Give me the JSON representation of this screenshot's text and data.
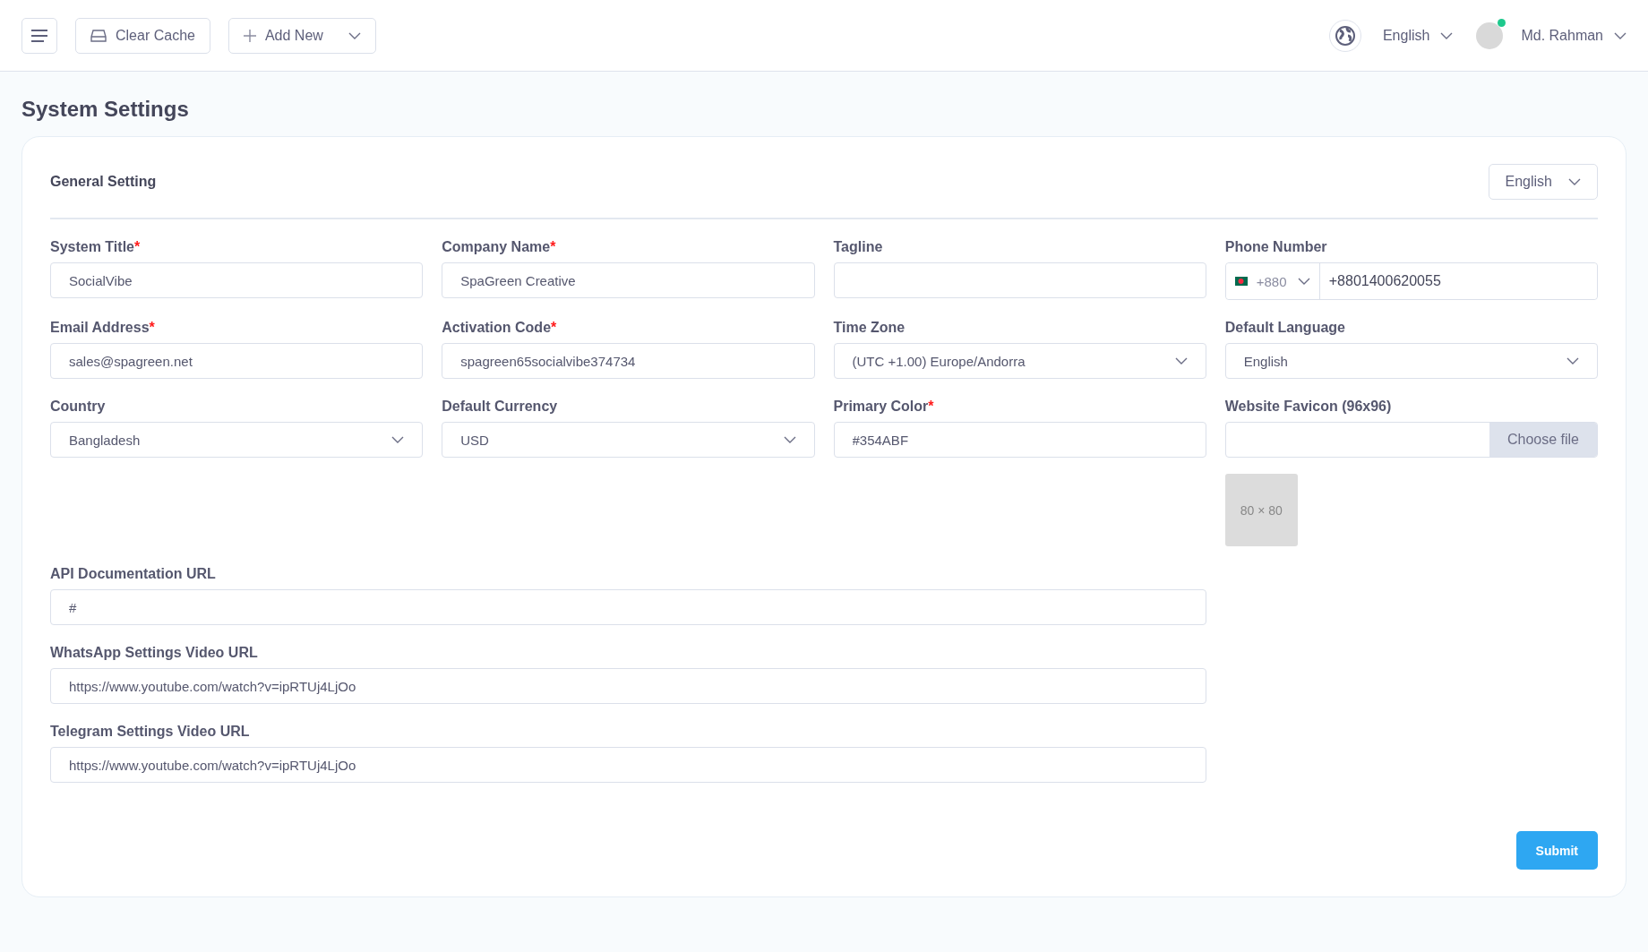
{
  "topbar": {
    "clear_cache": "Clear Cache",
    "add_new": "Add New",
    "language": "English",
    "user_name": "Md. Rahman",
    "user_online": true
  },
  "page_title": "System Settings",
  "card": {
    "title": "General Setting",
    "language_select": "English"
  },
  "fields": [
    {
      "kind": "text",
      "label": "System Title",
      "required_mark": "*",
      "value": "SocialVibe"
    },
    {
      "kind": "text",
      "label": "Company Name",
      "required_mark": "*",
      "value": "SpaGreen Creative"
    },
    {
      "kind": "text",
      "label": "Tagline"
    },
    {
      "kind": "phone",
      "label": "Phone Number",
      "code": "+880",
      "value": "+8801400620055"
    },
    {
      "kind": "text",
      "label": "Email Address",
      "required_mark": "*",
      "value": "sales@spagreen.net"
    },
    {
      "kind": "text",
      "label": "Activation Code",
      "required_mark": "*",
      "value": "spagreen65socialvibe374734"
    },
    {
      "kind": "select",
      "label": "Time Zone",
      "value": "(UTC +1.00) Europe/Andorra"
    },
    {
      "kind": "select",
      "label": "Default Language",
      "value": "English"
    },
    {
      "kind": "select",
      "label": "Country",
      "value": "Bangladesh"
    },
    {
      "kind": "select",
      "label": "Default Currency",
      "value": "USD"
    },
    {
      "kind": "text",
      "label": "Primary Color",
      "required_mark": "*",
      "value": "#354ABF"
    },
    {
      "kind": "file",
      "label": "Website Favicon (96x96)",
      "button": "Choose file",
      "preview": "80 × 80"
    }
  ],
  "wide_fields": [
    {
      "label": "API Documentation URL",
      "value": "#"
    },
    {
      "label": "WhatsApp Settings Video URL",
      "value": "https://www.youtube.com/watch?v=ipRTUj4LjOo"
    },
    {
      "label": "Telegram Settings Video URL",
      "value": "https://www.youtube.com/watch?v=ipRTUj4LjOo"
    }
  ],
  "submit": "Submit"
}
